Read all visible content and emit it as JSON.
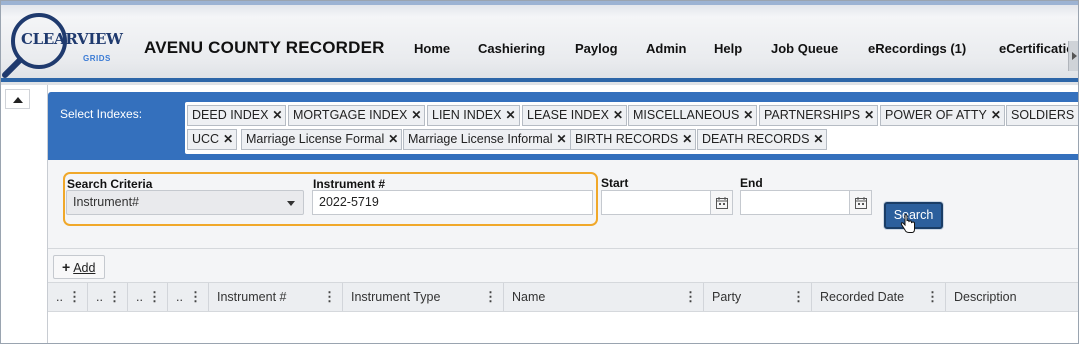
{
  "brand": {
    "logo_text": "CLEARVIEW",
    "logo_sub": "GRIDS",
    "app_title": "AVENU COUNTY RECORDER"
  },
  "nav": [
    "Home",
    "Cashiering",
    "Paylog",
    "Admin",
    "Help",
    "Job Queue",
    "eRecordings (1)",
    "eCertification"
  ],
  "indexes": {
    "label": "Select Indexes:",
    "chips": [
      "DEED INDEX",
      "MORTGAGE INDEX",
      "LIEN INDEX",
      "LEASE INDEX",
      "MISCELLANEOUS",
      "PARTNERSHIPS",
      "POWER OF ATTY",
      "SOLDIERS",
      "UCC",
      "Marriage License Formal",
      "Marriage License Informal",
      "BIRTH RECORDS",
      "DEATH RECORDS"
    ]
  },
  "criteria": {
    "search_criteria_label": "Search Criteria",
    "search_criteria_value": "Instrument#",
    "instrument_label": "Instrument #",
    "instrument_value": "2022-5719",
    "start_label": "Start",
    "start_value": "",
    "end_label": "End",
    "end_value": "",
    "search_button": "Search"
  },
  "toolbar": {
    "add_label": "Add"
  },
  "grid": {
    "columns": [
      "..",
      "..",
      "..",
      "..",
      "Instrument #",
      "Instrument Type",
      "Name",
      "Party",
      "Recorded Date",
      "Description"
    ]
  },
  "colors": {
    "header_blue": "#2d66a8",
    "panel_blue": "#3470bd",
    "highlight": "#f0a82a",
    "search_button": "#2c5f9c"
  }
}
